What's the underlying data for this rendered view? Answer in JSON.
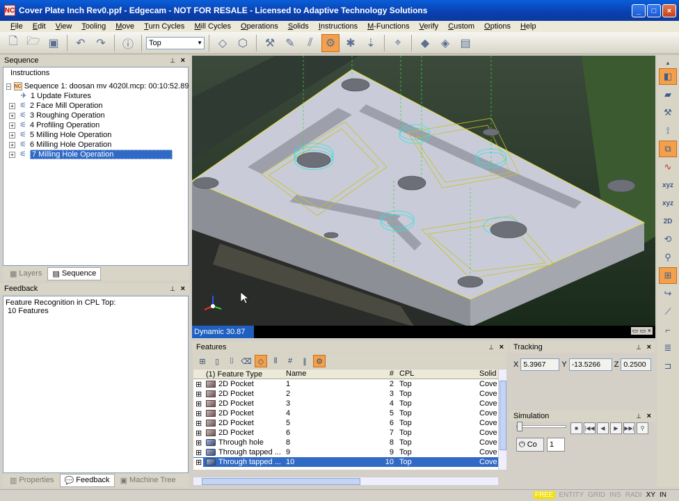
{
  "window": {
    "title": "Cover Plate Inch Rev0.ppf - Edgecam - NOT FOR RESALE - Licensed to Adaptive Technology Solutions",
    "app_icon": "NC"
  },
  "menu": [
    "File",
    "Edit",
    "View",
    "Tooling",
    "Move",
    "Turn Cycles",
    "Mill Cycles",
    "Operations",
    "Solids",
    "Instructions",
    "M-Functions",
    "Verify",
    "Custom",
    "Options",
    "Help"
  ],
  "toolbar": {
    "cpl_value": "Top"
  },
  "sequence_panel": {
    "header": "Sequence",
    "tab": "Instructions",
    "root": "Sequence 1: doosan mv 4020l.mcp: 00:10:52.89",
    "items": [
      "1 Update Fixtures",
      "2 Face Mill Operation",
      "3 Roughing Operation",
      "4 Profiling Operation",
      "5 Milling Hole Operation",
      "6 Milling Hole Operation",
      "7 Milling Hole Operation"
    ],
    "bottom_tabs": [
      "Layers",
      "Sequence"
    ]
  },
  "feedback_panel": {
    "header": "Feedback",
    "lines": [
      "Feature Recognition in CPL Top:",
      " 10 Features"
    ],
    "bottom_tabs": [
      "Properties",
      "Feedback",
      "Machine Tree"
    ]
  },
  "viewport": {
    "status": "Dynamic 30.87"
  },
  "features_panel": {
    "header": "Features",
    "columns": [
      "(1) Feature Type",
      "Name",
      "#",
      "CPL",
      "Solid"
    ],
    "rows": [
      {
        "type": "2D Pocket",
        "name": "1",
        "num": "2",
        "cpl": "Top",
        "solid": "Cove"
      },
      {
        "type": "2D Pocket",
        "name": "2",
        "num": "3",
        "cpl": "Top",
        "solid": "Cove"
      },
      {
        "type": "2D Pocket",
        "name": "3",
        "num": "4",
        "cpl": "Top",
        "solid": "Cove"
      },
      {
        "type": "2D Pocket",
        "name": "4",
        "num": "5",
        "cpl": "Top",
        "solid": "Cove"
      },
      {
        "type": "2D Pocket",
        "name": "5",
        "num": "6",
        "cpl": "Top",
        "solid": "Cove"
      },
      {
        "type": "2D Pocket",
        "name": "6",
        "num": "7",
        "cpl": "Top",
        "solid": "Cove"
      },
      {
        "type": "Through hole",
        "name": "8",
        "num": "8",
        "cpl": "Top",
        "solid": "Cove"
      },
      {
        "type": "Through tapped ...",
        "name": "9",
        "num": "9",
        "cpl": "Top",
        "solid": "Cove"
      },
      {
        "type": "Through tapped ...",
        "name": "10",
        "num": "10",
        "cpl": "Top",
        "solid": "Cove"
      }
    ]
  },
  "tracking_panel": {
    "header": "Tracking",
    "x_label": "X",
    "x": "5.3967",
    "y_label": "Y",
    "y": "-13.5266",
    "z_label": "Z",
    "z": "0.2500"
  },
  "simulation_panel": {
    "header": "Simulation",
    "co_label": "Co",
    "count": "1"
  },
  "status_bar": [
    "FREE",
    "ENTITY",
    "GRID",
    "INS",
    "RADI",
    "XY",
    "IN"
  ],
  "colors": {
    "title_bg": "#0a4fc8",
    "highlight": "#f2a04c",
    "selection": "#316ac5",
    "free_badge": "#f2e000"
  }
}
